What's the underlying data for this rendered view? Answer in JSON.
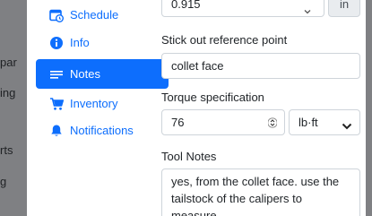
{
  "backdrop_fragments": [
    "par",
    "ing",
    "rts",
    "g"
  ],
  "nav": {
    "items": [
      {
        "label": "Schedule",
        "icon": "calendar-clock-icon",
        "active": false
      },
      {
        "label": "Info",
        "icon": "info-icon",
        "active": false
      },
      {
        "label": "Notes",
        "icon": "notes-icon",
        "active": true
      },
      {
        "label": "Inventory",
        "icon": "cart-icon",
        "active": false
      },
      {
        "label": "Notifications",
        "icon": "bell-icon",
        "active": false
      }
    ]
  },
  "form": {
    "top_value": "0.915",
    "top_unit": "in",
    "stick_out": {
      "label": "Stick out reference point",
      "value": "collet face"
    },
    "torque": {
      "label": "Torque specification",
      "value": "76",
      "unit": "lb·ft"
    },
    "tool_notes": {
      "label": "Tool Notes",
      "value": "yes, from the collet face. use the tailstock of the calipers to measure"
    }
  },
  "colors": {
    "accent": "#0d6efd",
    "backdrop": "#7f8083",
    "border": "#ced4da"
  }
}
